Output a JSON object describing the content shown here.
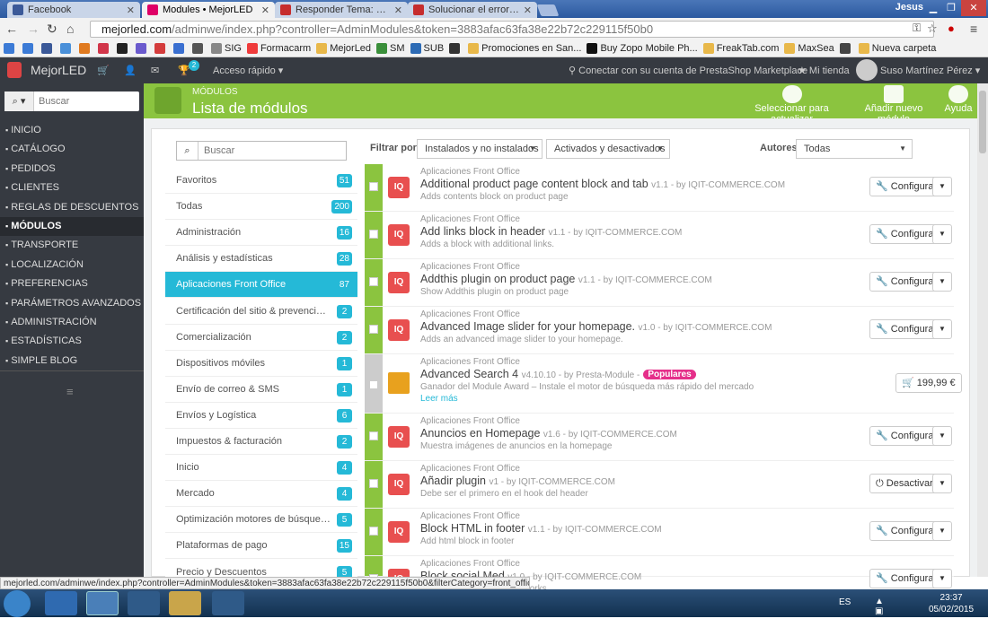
{
  "browser": {
    "tabs": [
      {
        "label": "Facebook",
        "color": "#3b5998"
      },
      {
        "label": "Modules • MejorLED",
        "color": "#df0067"
      },
      {
        "label": "Responder Tema: Errores c",
        "color": "#c62d2d"
      },
      {
        "label": "Solucionar el error \"módu",
        "color": "#c62d2d"
      }
    ],
    "window_user": "Jesus",
    "url_host": "mejorled.com",
    "url_path": "/adminwe/index.php?controller=AdminModules&token=3883afac63fa38e22b72c229115f50b0",
    "bookmarks": [
      {
        "label": "",
        "color": "#3c7bd6"
      },
      {
        "label": "",
        "color": "#3c7bd6"
      },
      {
        "label": "",
        "color": "#3b5998"
      },
      {
        "label": "",
        "color": "#4a90d9"
      },
      {
        "label": "",
        "color": "#e07a1f"
      },
      {
        "label": "",
        "color": "#d1364a"
      },
      {
        "label": "",
        "color": "#222222"
      },
      {
        "label": "",
        "color": "#6a5acd"
      },
      {
        "label": "",
        "color": "#d43c3c"
      },
      {
        "label": "",
        "color": "#3a6fd0"
      },
      {
        "label": "",
        "color": "#555555"
      },
      {
        "label": "SIG",
        "color": "#888888"
      },
      {
        "label": "Formacarm",
        "color": "#ef3b3b"
      },
      {
        "label": "MejorLed",
        "color": "#e8b84a"
      },
      {
        "label": "SM",
        "color": "#3a8f3a"
      },
      {
        "label": "SUB",
        "color": "#2d6bb5"
      },
      {
        "label": "",
        "color": "#333333"
      },
      {
        "label": "Promociones en San...",
        "color": "#e8b84a"
      },
      {
        "label": "Buy Zopo Mobile Ph...",
        "color": "#111111"
      },
      {
        "label": "FreakTab.com",
        "color": "#e8b84a"
      },
      {
        "label": "MaxSea",
        "color": "#e8b84a"
      },
      {
        "label": "",
        "color": "#444444"
      },
      {
        "label": "Nueva carpeta",
        "color": "#e8b84a"
      }
    ],
    "status_url": "mejorled.com/adminwe/index.php?controller=AdminModules&token=3883afac63fa38e22b72c229115f50b0&filterCategory=front_office_features"
  },
  "header": {
    "logo": "MejorLED",
    "notification_count": "2",
    "quick_access": "Acceso rápido",
    "marketplace": "Conectar con su cuenta de PrestaShop Marketplace",
    "my_shop": "Mi tienda",
    "user": "Suso Martínez Pérez"
  },
  "sidebar": {
    "search_placeholder": "Buscar",
    "items": [
      {
        "label": "INICIO",
        "active": false
      },
      {
        "label": "CATÁLOGO",
        "active": false
      },
      {
        "label": "PEDIDOS",
        "active": false
      },
      {
        "label": "CLIENTES",
        "active": false
      },
      {
        "label": "REGLAS DE DESCUENTOS",
        "active": false
      },
      {
        "label": "MÓDULOS",
        "active": true
      },
      {
        "label": "TRANSPORTE",
        "active": false
      },
      {
        "label": "LOCALIZACIÓN",
        "active": false
      },
      {
        "label": "PREFERENCIAS",
        "active": false
      },
      {
        "label": "PARÁMETROS AVANZADOS",
        "active": false
      },
      {
        "label": "ADMINISTRACIÓN",
        "active": false
      },
      {
        "label": "ESTADÍSTICAS",
        "active": false
      },
      {
        "label": "SIMPLE BLOG",
        "active": false
      }
    ]
  },
  "page": {
    "breadcrumb": "MÓDULOS",
    "title": "Lista de módulos",
    "toolbar": {
      "update": "Seleccionar para actualizar",
      "add": "Añadir nuevo módulo",
      "help": "Ayuda"
    }
  },
  "categories": {
    "search_placeholder": "Buscar",
    "items": [
      {
        "label": "Favoritos",
        "count": "51"
      },
      {
        "label": "Todas",
        "count": "200"
      },
      {
        "label": "Administración",
        "count": "16"
      },
      {
        "label": "Análisis y estadísticas",
        "count": "28"
      },
      {
        "label": "Aplicaciones Front Office",
        "count": "87",
        "active": true
      },
      {
        "label": "Certificación del sitio & prevención del...",
        "count": "2"
      },
      {
        "label": "Comercialización",
        "count": "2"
      },
      {
        "label": "Dispositivos móviles",
        "count": "1"
      },
      {
        "label": "Envío de correo & SMS",
        "count": "1"
      },
      {
        "label": "Envíos y Logística",
        "count": "6"
      },
      {
        "label": "Impuestos & facturación",
        "count": "2"
      },
      {
        "label": "Inicio",
        "count": "4"
      },
      {
        "label": "Mercado",
        "count": "4"
      },
      {
        "label": "Optimización motores de búsqueda (S...",
        "count": "5"
      },
      {
        "label": "Plataformas de pago",
        "count": "15"
      },
      {
        "label": "Precio y Descuentos",
        "count": "5"
      }
    ]
  },
  "filters": {
    "label": "Filtrar por",
    "installed": "Instalados y no instalados",
    "enabled": "Activados y desactivados",
    "authors_label": "Autores",
    "authors": "Todas"
  },
  "modules": [
    {
      "category": "Aplicaciones Front Office",
      "name": "Additional product page content block and tab",
      "version": "v1.1 - by IQIT-COMMERCE.COM",
      "desc": "Adds contents block on product page",
      "action": "Configurar",
      "logo": "IQ"
    },
    {
      "category": "Aplicaciones Front Office",
      "name": "Add links block in header",
      "version": "v1.1 - by IQIT-COMMERCE.COM",
      "desc": "Adds a block with additional links.",
      "action": "Configurar",
      "logo": "IQ"
    },
    {
      "category": "Aplicaciones Front Office",
      "name": "Addthis plugin on product page",
      "version": "v1.1 - by IQIT-COMMERCE.COM",
      "desc": "Show Addthis plugin on product page",
      "action": "Configurar",
      "logo": "IQ"
    },
    {
      "category": "Aplicaciones Front Office",
      "name": "Advanced Image slider for your homepage.",
      "version": "v1.0 - by IQIT-COMMERCE.COM",
      "desc": "Adds an advanced image slider to your homepage.",
      "action": "Configurar",
      "logo": "IQ"
    },
    {
      "category": "Aplicaciones Front Office",
      "name": "Advanced Search 4",
      "version": "v4.10.10 - by Presta-Module -",
      "desc": "Ganador del Module Award – Instale el motor de búsqueda más rápido del mercado",
      "action": "199,99 €",
      "logo": "",
      "badge": "Populares",
      "more": "Leer más"
    },
    {
      "category": "Aplicaciones Front Office",
      "name": "Anuncios en Homepage",
      "version": "v1.6 - by IQIT-COMMERCE.COM",
      "desc": "Muestra imágenes de anuncios en la homepage",
      "action": "Configurar",
      "logo": "IQ"
    },
    {
      "category": "Aplicaciones Front Office",
      "name": "Añadir plugin",
      "version": "v1 - by IQIT-COMMERCE.COM",
      "desc": "Debe ser el primero en el hook del header",
      "action": "Desactivar",
      "logo": "IQ"
    },
    {
      "category": "Aplicaciones Front Office",
      "name": "Block HTML in footer",
      "version": "v1.1 - by IQIT-COMMERCE.COM",
      "desc": "Add html block in footer",
      "action": "Configurar",
      "logo": "IQ"
    },
    {
      "category": "Aplicaciones Front Office",
      "name": "Block social Med",
      "version": "v1.0 - by IQIT-COMMERCE.COM",
      "desc": "...rmation about social networks",
      "action": "Configurar",
      "logo": "IQ"
    }
  ],
  "taskbar": {
    "lang": "ES",
    "time": "23:37",
    "date": "05/02/2015"
  }
}
